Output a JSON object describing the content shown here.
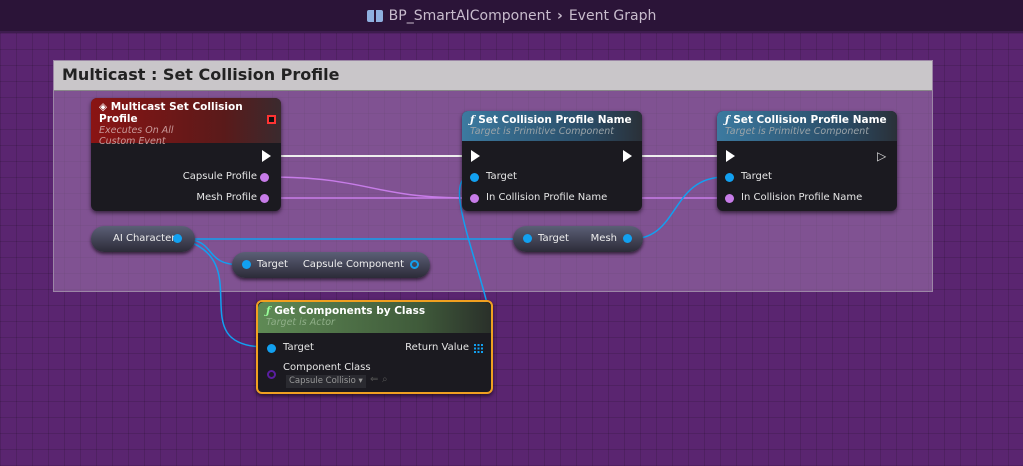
{
  "breadcrumb": {
    "blueprint": "BP_SmartAIComponent",
    "graph": "Event Graph",
    "icon": "blueprint-icon"
  },
  "comment": {
    "title": "Multicast : Set Collision Profile"
  },
  "event_node": {
    "title": "Multicast Set Collision Profile",
    "sub1": "Executes On All",
    "sub2": "Custom Event",
    "pins": [
      "Capsule Profile",
      "Mesh Profile"
    ]
  },
  "set1": {
    "title": "Set Collision Profile Name",
    "sub": "Target is Primitive Component",
    "pins": [
      "Target",
      "In Collision Profile Name"
    ]
  },
  "set2": {
    "title": "Set Collision Profile Name",
    "sub": "Target is Primitive Component",
    "pins": [
      "Target",
      "In Collision Profile Name"
    ]
  },
  "ai_var": {
    "label": "AI Character"
  },
  "capsule_get": {
    "in": "Target",
    "out": "Capsule Component"
  },
  "mesh_get": {
    "in": "Target",
    "out": "Mesh"
  },
  "getcomp": {
    "title": "Get Components by Class",
    "sub": "Target is Actor",
    "target": "Target",
    "ret": "Return Value",
    "cls": "Component Class",
    "cls_value": "Capsule Collisio"
  },
  "colors": {
    "exec": "#ffffff",
    "object": "#12a0f0",
    "name": "#c77ce8",
    "bg": "#5a2570"
  }
}
